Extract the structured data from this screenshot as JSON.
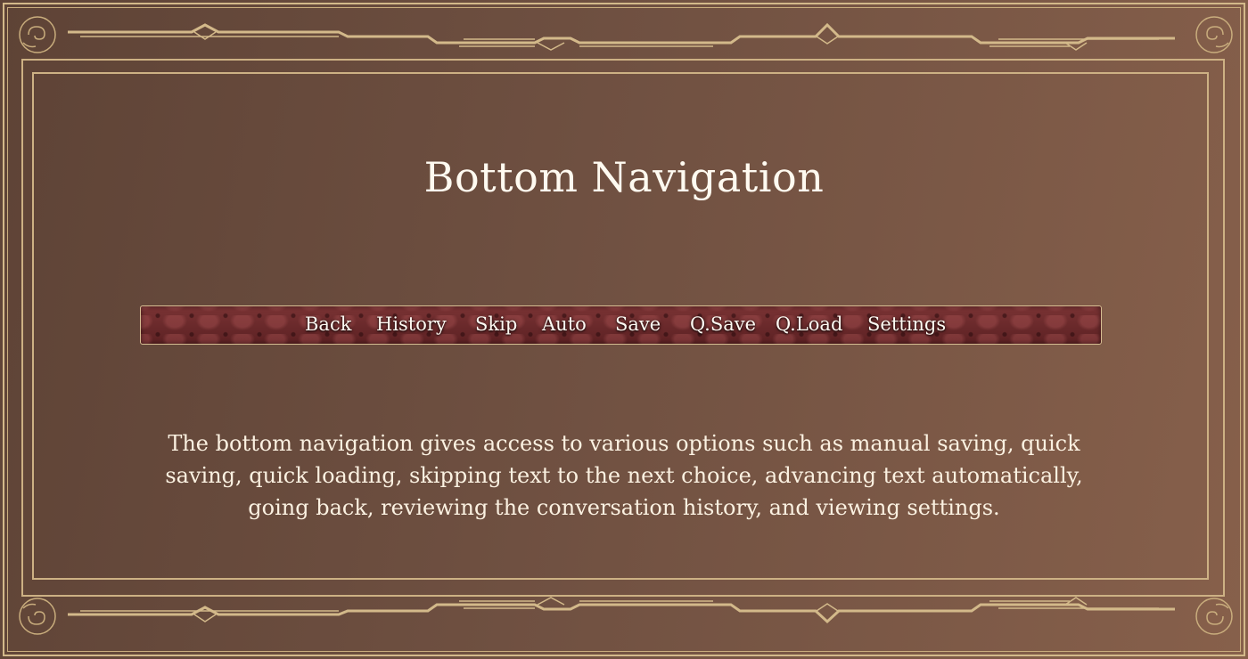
{
  "page": {
    "title": "Bottom Navigation",
    "description": "The bottom navigation gives access to various options such as manual saving, quick saving, quick loading, skipping text to the next choice, advancing text automatically, going back, reviewing the conversation history, and viewing settings."
  },
  "nav": {
    "items": [
      {
        "label": "Back"
      },
      {
        "label": "History"
      },
      {
        "label": "Skip"
      },
      {
        "label": "Auto"
      },
      {
        "label": "Save"
      },
      {
        "label": "Q.Save"
      },
      {
        "label": "Q.Load"
      },
      {
        "label": "Settings"
      }
    ]
  },
  "colors": {
    "background": "#6f5041",
    "gold_trim": "#d3b98a",
    "navbar": "#6b2a2b",
    "text": "#fbf2e2"
  },
  "icons": {
    "corners": "swirl-ornament-icon",
    "border": "art-deco-border"
  }
}
